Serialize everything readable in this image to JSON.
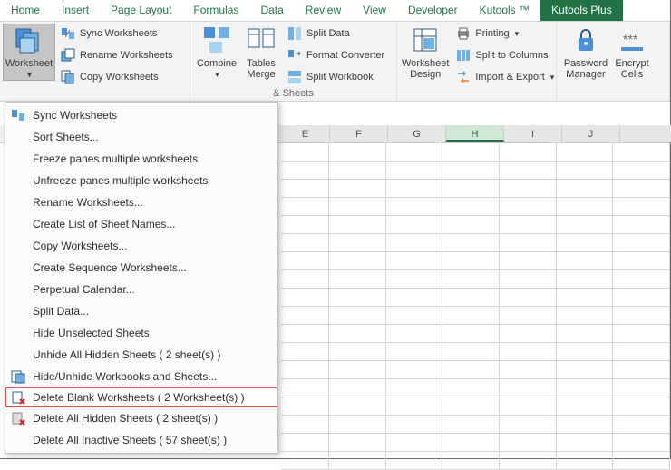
{
  "tabs": {
    "home": "Home",
    "insert": "Insert",
    "page_layout": "Page Layout",
    "formulas": "Formulas",
    "data": "Data",
    "review": "Review",
    "view": "View",
    "developer": "Developer",
    "kutools": "Kutools ™",
    "kutools_plus": "Kutools Plus"
  },
  "ribbon": {
    "worksheet": "Worksheet",
    "sync": "Sync Worksheets",
    "rename": "Rename Worksheets",
    "copy": "Copy Worksheets",
    "combine": "Combine",
    "tables_merge": "Tables Merge",
    "split_data": "Split Data",
    "format_converter": "Format Converter",
    "split_workbook": "Split Workbook",
    "worksheet_design": "Worksheet Design",
    "printing": "Printing",
    "split_to_columns": "Split to Columns",
    "import_export": "Import & Export",
    "password_manager": "Password Manager",
    "encrypt_cells": "Encrypt Cells",
    "group_sheets": "& Sheets"
  },
  "columns": {
    "e": "E",
    "f": "F",
    "g": "G",
    "h": "H",
    "i": "I",
    "j": "J"
  },
  "menu": {
    "sync": "Sync Worksheets",
    "sort": "Sort Sheets...",
    "freeze": "Freeze panes multiple worksheets",
    "unfreeze": "Unfreeze panes multiple worksheets",
    "rename": "Rename Worksheets...",
    "create_list": "Create List of Sheet Names...",
    "copy": "Copy Worksheets...",
    "create_seq": "Create Sequence Worksheets...",
    "perpetual": "Perpetual Calendar...",
    "split_data": "Split Data...",
    "hide_unselected": "Hide Unselected Sheets",
    "unhide_hidden": "Unhide All Hidden Sheets ( 2 sheet(s) )",
    "hide_unhide_wb": "Hide/Unhide Workbooks and Sheets...",
    "delete_blank": "Delete Blank Worksheets ( 2 Worksheet(s) )",
    "delete_hidden": "Delete All Hidden Sheets ( 2 sheet(s) )",
    "delete_inactive": "Delete All Inactive Sheets ( 57 sheet(s) )"
  }
}
